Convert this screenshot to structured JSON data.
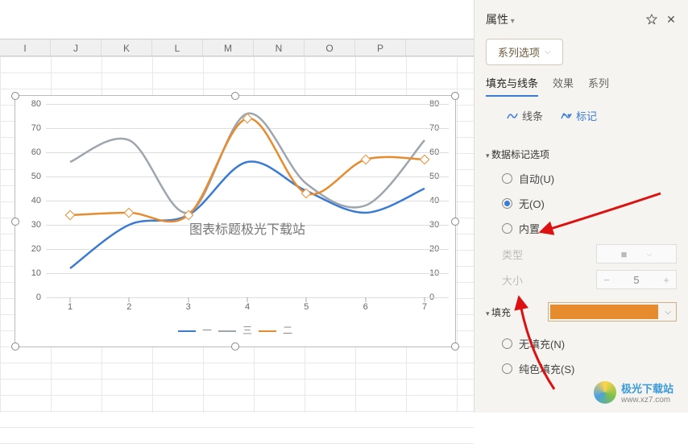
{
  "columns": [
    "I",
    "J",
    "K",
    "L",
    "M",
    "N",
    "O",
    "P"
  ],
  "panel": {
    "title": "属性",
    "series_button": "系列选项",
    "tabs": [
      "填充与线条",
      "效果",
      "系列"
    ],
    "subtabs": {
      "line": "线条",
      "marker": "标记"
    },
    "section_marker": "数据标记选项",
    "radios": {
      "auto": "自动(U)",
      "none": "无(O)",
      "builtin": "内置"
    },
    "type_label": "类型",
    "size_label": "大小",
    "size_value": "5",
    "section_fill": "填充",
    "fill_color": "#e78b2f",
    "fill_radios": {
      "none": "无填充(N)",
      "solid": "纯色填充(S)"
    }
  },
  "chart_data": {
    "type": "line",
    "title": "图表标题极光下载站",
    "x": [
      1,
      2,
      3,
      4,
      5,
      6,
      7
    ],
    "ylim": [
      0,
      80
    ],
    "yticks": [
      0,
      10,
      20,
      30,
      40,
      50,
      60,
      70,
      80
    ],
    "series": [
      {
        "name": "一",
        "color": "#3a7bd5",
        "values": [
          12,
          30,
          34,
          56,
          44,
          35,
          45
        ],
        "markers": false
      },
      {
        "name": "三",
        "color": "#9ea6ad",
        "values": [
          56,
          65,
          35,
          76,
          47,
          38,
          65
        ],
        "markers": false
      },
      {
        "name": "二",
        "color": "#e78b2f",
        "values": [
          34,
          35,
          34,
          74,
          43,
          57,
          57
        ],
        "markers": true
      }
    ],
    "legend": [
      "一",
      "三",
      "二"
    ]
  },
  "watermark": {
    "cn": "极光下载站",
    "url": "www.xz7.com"
  }
}
